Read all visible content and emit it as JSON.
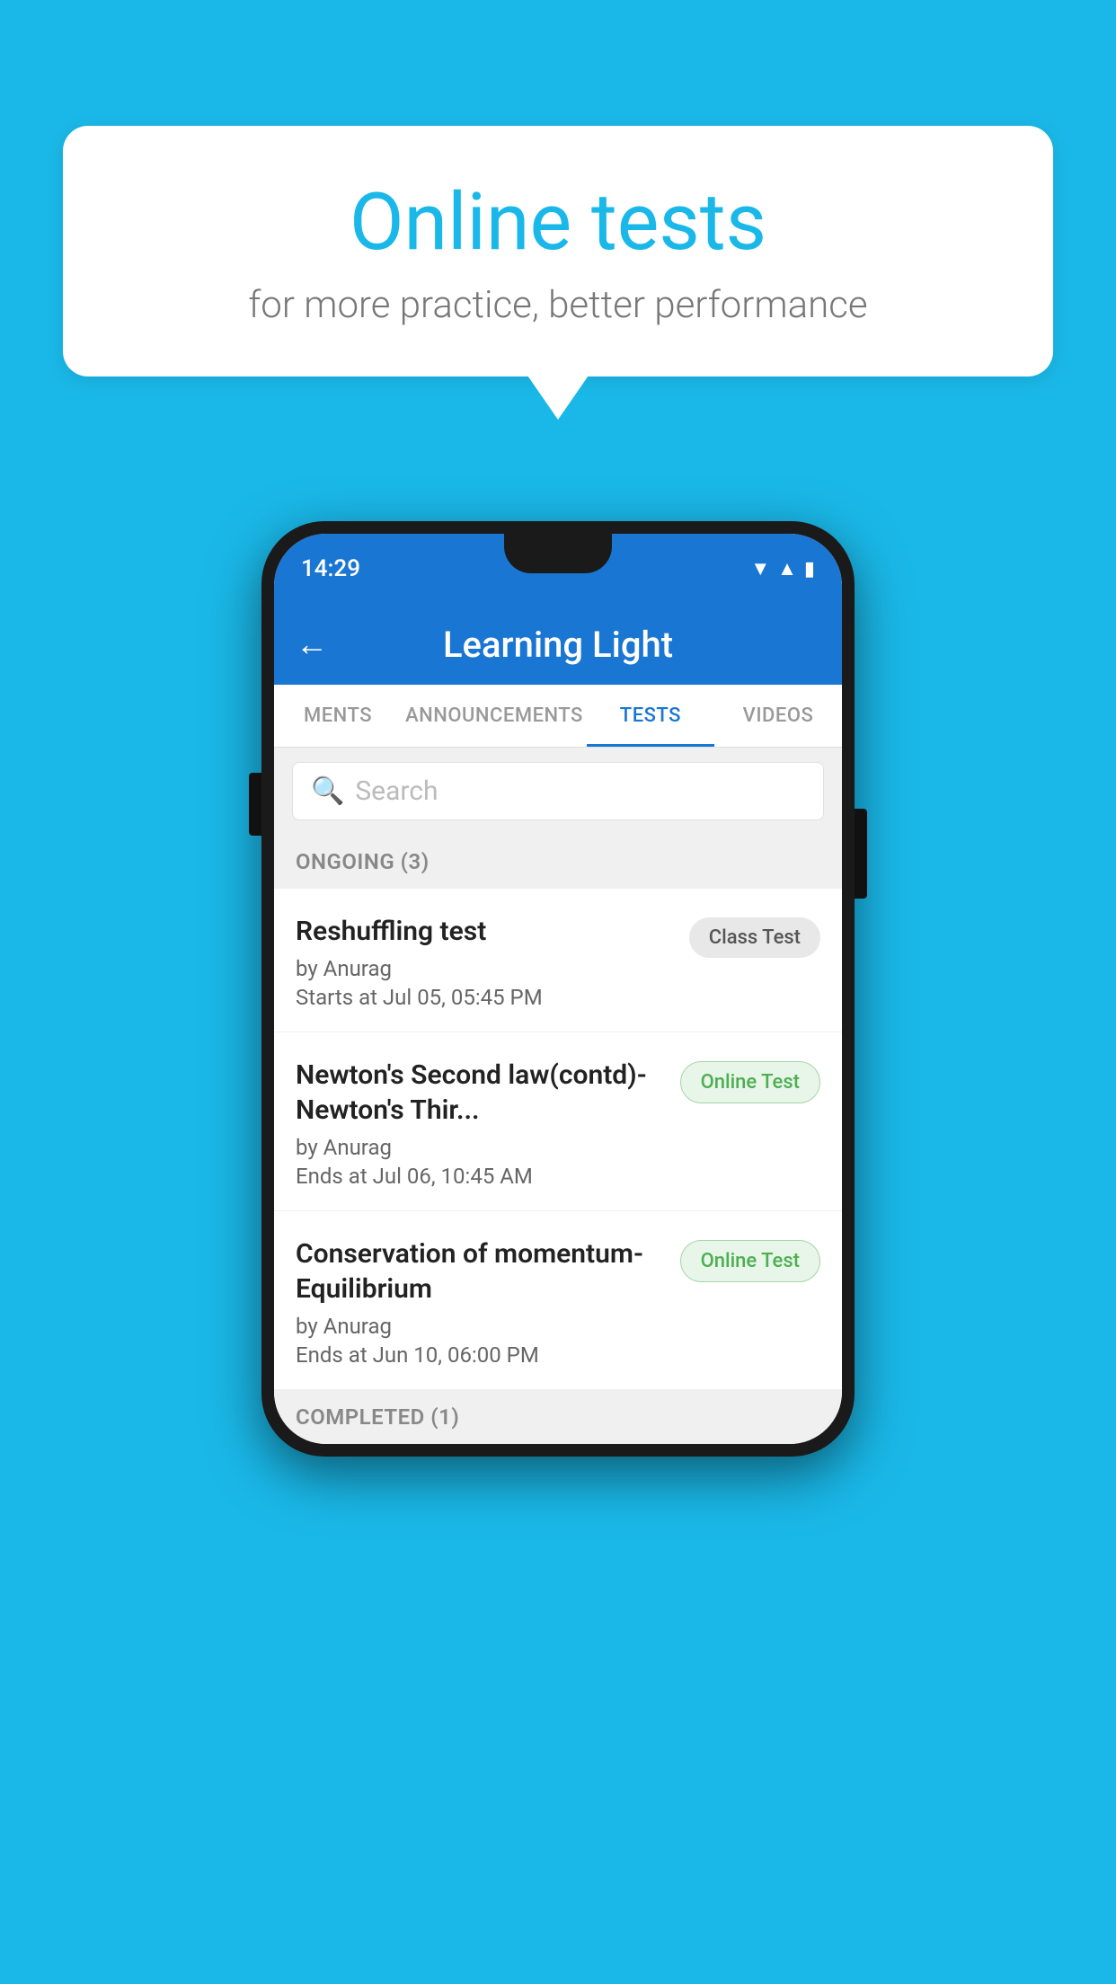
{
  "background_color": "#1ab8e8",
  "bubble": {
    "title": "Online tests",
    "subtitle": "for more practice, better performance"
  },
  "phone": {
    "status_bar": {
      "time": "14:29"
    },
    "app_bar": {
      "back_label": "←",
      "title": "Learning Light"
    },
    "tabs": [
      {
        "label": "MENTS",
        "active": false
      },
      {
        "label": "ANNOUNCEMENTS",
        "active": false
      },
      {
        "label": "TESTS",
        "active": true
      },
      {
        "label": "VIDEOS",
        "active": false
      }
    ],
    "search": {
      "placeholder": "Search"
    },
    "sections": [
      {
        "header": "ONGOING (3)",
        "items": [
          {
            "name": "Reshuffling test",
            "by": "by Anurag",
            "time": "Starts at  Jul 05, 05:45 PM",
            "badge": "Class Test",
            "badge_type": "class"
          },
          {
            "name": "Newton's Second law(contd)-Newton's Thir...",
            "by": "by Anurag",
            "time": "Ends at  Jul 06, 10:45 AM",
            "badge": "Online Test",
            "badge_type": "online"
          },
          {
            "name": "Conservation of momentum-Equilibrium",
            "by": "by Anurag",
            "time": "Ends at  Jun 10, 06:00 PM",
            "badge": "Online Test",
            "badge_type": "online"
          }
        ]
      }
    ],
    "completed_header": "COMPLETED (1)"
  }
}
